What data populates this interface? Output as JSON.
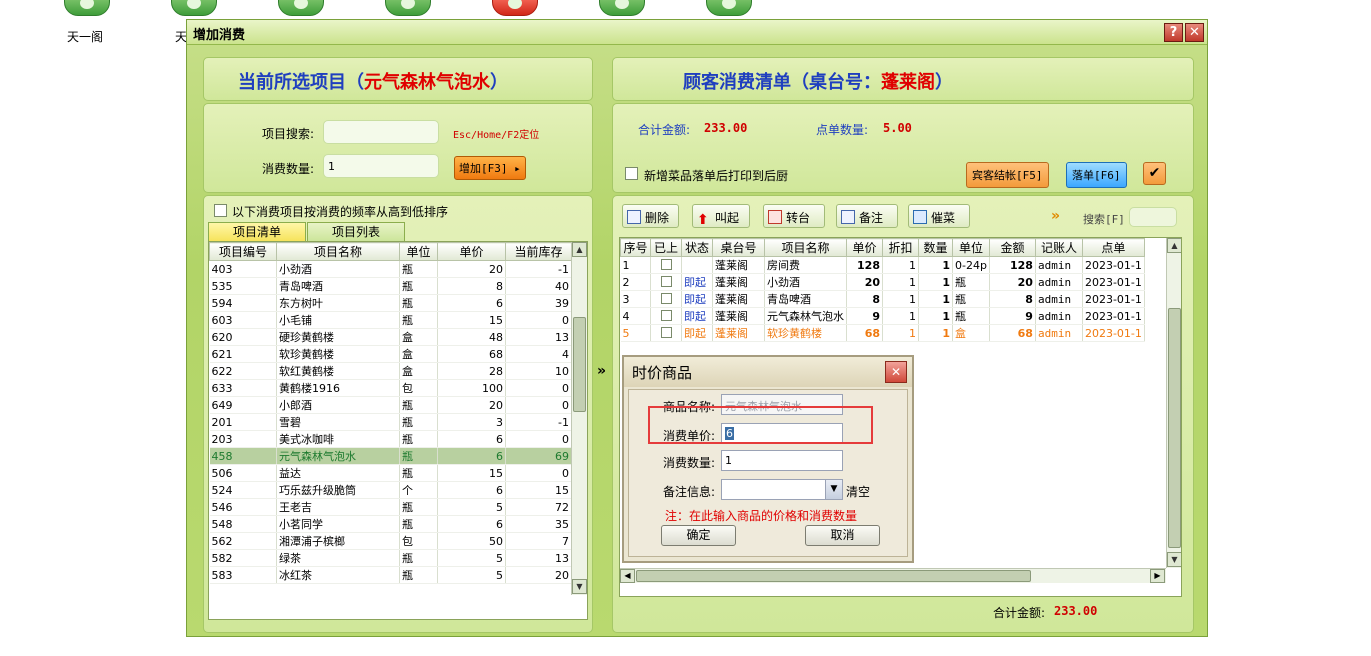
{
  "desktop": {
    "labels": [
      "天一阁",
      "天"
    ]
  },
  "window": {
    "title": "增加消费",
    "help_label": "?",
    "close_label": "✕"
  },
  "left": {
    "header_prefix": "当前所选项目（",
    "header_item": "元气森林气泡水",
    "header_suffix": "）",
    "search_label": "项目搜索:",
    "search_value": "",
    "search_hint": "Esc/Home/F2定位",
    "qty_label": "消费数量:",
    "qty_value": "1",
    "add_button": "增加[F3]",
    "sort_label": "以下消费项目按消费的频率从高到低排序",
    "tabs": [
      "项目清单",
      "项目列表"
    ],
    "columns": [
      "项目编号",
      "项目名称",
      "单位",
      "单价",
      "当前库存"
    ],
    "rows": [
      [
        "403",
        "小劲酒",
        "瓶",
        "20",
        "-1"
      ],
      [
        "535",
        "青岛啤酒",
        "瓶",
        "8",
        "40"
      ],
      [
        "594",
        "东方树叶",
        "瓶",
        "6",
        "39"
      ],
      [
        "603",
        "小毛铺",
        "瓶",
        "15",
        "0"
      ],
      [
        "620",
        "硬珍黄鹤楼",
        "盒",
        "48",
        "13"
      ],
      [
        "621",
        "软珍黄鹤楼",
        "盒",
        "68",
        "4"
      ],
      [
        "622",
        "软红黄鹤楼",
        "盒",
        "28",
        "10"
      ],
      [
        "633",
        "黄鹤楼1916",
        "包",
        "100",
        "0"
      ],
      [
        "649",
        "小郎酒",
        "瓶",
        "20",
        "0"
      ],
      [
        "201",
        "雪碧",
        "瓶",
        "3",
        "-1"
      ],
      [
        "203",
        "美式冰咖啡",
        "瓶",
        "6",
        "0"
      ],
      [
        "458",
        "元气森林气泡水",
        "瓶",
        "6",
        "69"
      ],
      [
        "506",
        "益达",
        "瓶",
        "15",
        "0"
      ],
      [
        "524",
        "巧乐兹升级脆筒",
        "个",
        "6",
        "15"
      ],
      [
        "546",
        "王老吉",
        "瓶",
        "5",
        "72"
      ],
      [
        "548",
        "小茗同学",
        "瓶",
        "6",
        "35"
      ],
      [
        "562",
        "湘潭浦子槟榔",
        "包",
        "50",
        "7"
      ],
      [
        "582",
        "绿茶",
        "瓶",
        "5",
        "13"
      ],
      [
        "583",
        "冰红茶",
        "瓶",
        "5",
        "20"
      ]
    ],
    "selected_row_index": 11
  },
  "right": {
    "header_prefix": "顾客消费清单（桌台号：",
    "header_table": "蓬莱阁",
    "header_suffix": "）",
    "total_label": "合计金额:",
    "total_value": "233.00",
    "count_label": "点单数量:",
    "count_value": "5.00",
    "print_label": "新增菜品落单后打印到后厨",
    "checkout_button": "宾客结帐[F5]",
    "order_button": "落单[F6]",
    "toolbar": [
      "删除",
      "叫起",
      "转台",
      "备注",
      "催菜"
    ],
    "search_label": "搜索[F]",
    "columns": [
      "序号",
      "已上",
      "状态",
      "桌台号",
      "项目名称",
      "单价",
      "折扣",
      "数量",
      "单位",
      "金额",
      "记账人",
      "点单"
    ],
    "rows": [
      [
        "1",
        "",
        "",
        "蓬莱阁",
        "房间费",
        "128",
        "1",
        "1",
        "0-24p",
        "128",
        "admin",
        "2023-01-1"
      ],
      [
        "2",
        "",
        "即起",
        "蓬莱阁",
        "小劲酒",
        "20",
        "1",
        "1",
        "瓶",
        "20",
        "admin",
        "2023-01-1"
      ],
      [
        "3",
        "",
        "即起",
        "蓬莱阁",
        "青岛啤酒",
        "8",
        "1",
        "1",
        "瓶",
        "8",
        "admin",
        "2023-01-1"
      ],
      [
        "4",
        "",
        "即起",
        "蓬莱阁",
        "元气森林气泡水",
        "9",
        "1",
        "1",
        "瓶",
        "9",
        "admin",
        "2023-01-1"
      ],
      [
        "5",
        "",
        "即起",
        "蓬莱阁",
        "软珍黄鹤楼",
        "68",
        "1",
        "1",
        "盒",
        "68",
        "admin",
        "2023-01-1"
      ]
    ],
    "footer_total_label": "合计金额:",
    "footer_total_value": "233.00",
    "expand_arrow": "»"
  },
  "dialog": {
    "title": "时价商品",
    "name_label": "商品名称:",
    "name_value": "元气森林气泡水",
    "price_label": "消费单价:",
    "price_value": "6",
    "qty_label": "消费数量:",
    "qty_value": "1",
    "remark_label": "备注信息:",
    "remark_value": "",
    "clear_label": "清空",
    "note": "注：在此输入商品的价格和消费数量",
    "ok_button": "确定",
    "cancel_button": "取消"
  },
  "colors": {
    "accent_blue": "#1f3fbf",
    "accent_red": "#e00000",
    "window_green": "#b2d467"
  }
}
